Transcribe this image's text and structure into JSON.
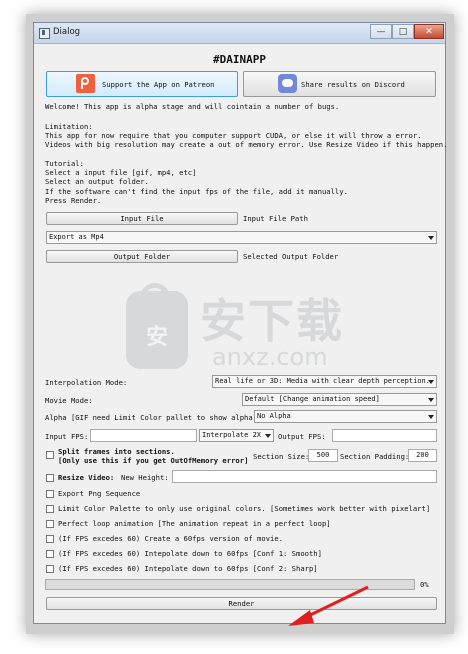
{
  "window": {
    "title": "Dialog",
    "min_glyph": "—",
    "max_glyph": "□",
    "close_glyph": "✕"
  },
  "heading": "#DAINAPP",
  "buttons": {
    "patreon": "Support the App on Patreon",
    "patreon_icon_caption": "patreon",
    "discord": "Share results on Discord",
    "input_file": "Input File",
    "output_folder": "Output Folder",
    "render": "Render"
  },
  "intro": {
    "welcome": "Welcome! This app is alpha stage and will cointain a number of bugs.",
    "limitation_title": "Limitation:",
    "limitation_1": "This app for now require that you computer support CUDA, or else it will throw a error.",
    "limitation_2": "Videos with big resolution may create a out of memory error. Use Resize Video if this happen.",
    "tutorial_title": "Tutorial:",
    "tutorial_1": "Select a input file [gif, mp4, etc]",
    "tutorial_2": "Select an output folder.",
    "tutorial_3": "If the software can't find the input fps of the file, add it manually.",
    "tutorial_4": "Press Render."
  },
  "paths": {
    "input_path": "Input File Path",
    "output_path": "Selected Output Folder"
  },
  "export": {
    "selected": "Export as Mp4"
  },
  "settings": {
    "interpolation_label": "Interpolation Mode:",
    "interpolation_value": "Real life or 3D: Media with clear depth perception.",
    "movie_label": "Movie Mode:",
    "movie_value": "Default [Change animation speed]",
    "alpha_label": "Alpha [GIF need Limit Color pallet to show alpha]:",
    "alpha_value": "No Alpha",
    "input_fps_label": "Input FPS:",
    "input_fps_value": "",
    "interpolate_value": "Interpolate 2X",
    "output_fps_label": "Output FPS:",
    "output_fps_value": ""
  },
  "options": {
    "split_line1": "Split frames into sections.",
    "split_line2": "[Only use this if you get OutOfMemory error]",
    "section_size_label": "Section Size:",
    "section_size_value": "500",
    "section_padding_label": "Section Padding:",
    "section_padding_value": "200",
    "resize_label": "Resize Video:",
    "new_height_label": "New Height:",
    "new_height_value": "",
    "export_png": "Export Png Sequence",
    "limit_palette": "Limit Color Palette to only use original colors. [Sometimes work better with pixelart]",
    "perfect_loop": "Perfect loop animation [The animation repeat in a perfect loop]",
    "fps60": "(If FPS excedes 60) Create a 60fps version of movie.",
    "conf1": "(If FPS excedes 60) Intepolate down to 60fps [Conf 1: Smooth]",
    "conf2": "(If FPS excedes 60) Intepolate down to 60fps [Conf 2: Sharp]"
  },
  "progress": {
    "value": 0,
    "label": "0%"
  },
  "watermark": {
    "cn": "安下载",
    "en": "anxz.com",
    "bag_char": "安"
  },
  "colors": {
    "accent": "#3c9de0",
    "patreon": "#f0603b",
    "discord": "#7289da",
    "annotation_arrow": "#e02020"
  }
}
